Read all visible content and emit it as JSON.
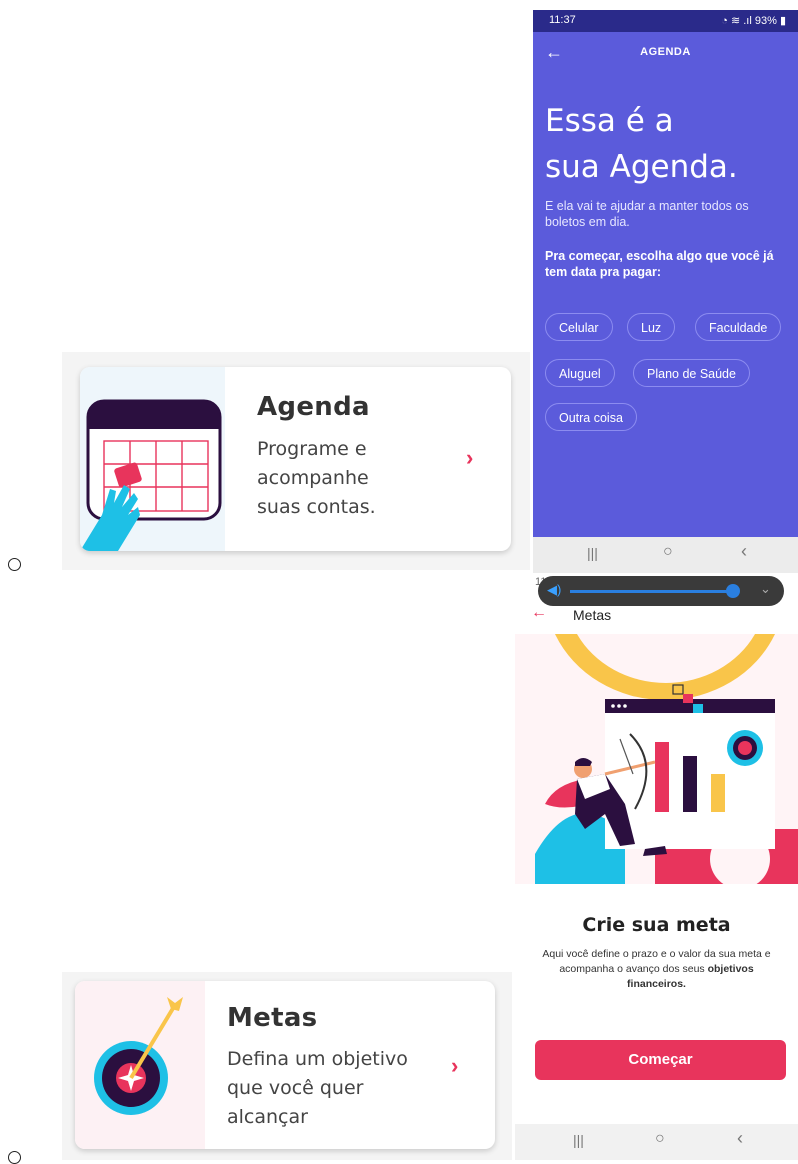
{
  "agenda_card": {
    "title": "Agenda",
    "desc_line1": "Programe e",
    "desc_line2": "acompanhe",
    "desc_line3": "suas contas.",
    "chevron": "›",
    "icon": "calendar-icon"
  },
  "metas_card": {
    "title": "Metas",
    "desc_line1": "Defina um objetivo",
    "desc_line2": "que você quer",
    "desc_line3": "alcançar",
    "chevron": "›",
    "icon": "target-icon"
  },
  "agenda_phone": {
    "status_time": "11:37",
    "status_battery": "93%",
    "header_title": "AGENDA",
    "back": "←",
    "headline_line1": "Essa é a",
    "headline_line2": "sua Agenda.",
    "subtitle": "E ela vai te ajudar a manter todos os boletos em dia.",
    "prompt": "Pra começar, escolha algo que você já tem data pra pagar:",
    "chips": [
      "Celular",
      "Luz",
      "Faculdade",
      "Aluguel",
      "Plano de Saúde",
      "Outra coisa"
    ],
    "nav": {
      "recent": "|||",
      "home": "○",
      "back": "‹"
    }
  },
  "metas_phone": {
    "status_time": "11:37",
    "back": "←",
    "title": "Metas",
    "heading": "Crie sua meta",
    "text_before_bold": "Aqui você define o prazo e o valor da sua meta e acompanha o avanço dos seus ",
    "text_bold": "objetivos financeiros.",
    "button_label": "Começar",
    "nav": {
      "recent": "|||",
      "home": "○",
      "back": "‹"
    }
  },
  "colors": {
    "agenda_bg": "#5b5bdb",
    "accent_pink": "#e8345c",
    "dark_purple": "#2b0f3f",
    "teal": "#1ec0e6",
    "yellow": "#f9c54a"
  }
}
